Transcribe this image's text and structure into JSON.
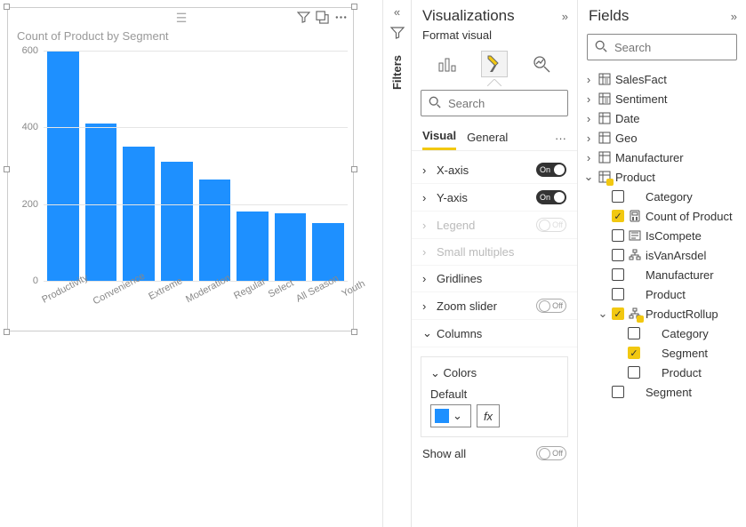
{
  "chart_data": {
    "type": "bar",
    "title": "Count of Product by Segment",
    "categories": [
      "Productivity",
      "Convenience",
      "Extreme",
      "Moderation",
      "Regular",
      "Select",
      "All Season",
      "Youth"
    ],
    "values": [
      600,
      410,
      350,
      310,
      265,
      180,
      175,
      150
    ],
    "ylim": [
      0,
      600
    ],
    "yticks": [
      0,
      200,
      400,
      600
    ],
    "xlabel": "",
    "ylabel": ""
  },
  "filters_label": "Filters",
  "viz": {
    "title": "Visualizations",
    "subtitle": "Format visual",
    "search_placeholder": "Search",
    "tabs": {
      "visual": "Visual",
      "general": "General"
    },
    "rows": {
      "xaxis": {
        "label": "X-axis",
        "state": "on",
        "toggle_text": "On"
      },
      "yaxis": {
        "label": "Y-axis",
        "state": "on",
        "toggle_text": "On"
      },
      "legend": {
        "label": "Legend",
        "state": "off",
        "toggle_text": "Off"
      },
      "small": {
        "label": "Small multiples",
        "state": "none"
      },
      "grid": {
        "label": "Gridlines",
        "state": "none"
      },
      "zoom": {
        "label": "Zoom slider",
        "state": "off",
        "toggle_text": "Off"
      },
      "columns": {
        "label": "Columns",
        "state": "none"
      }
    },
    "colors": {
      "title": "Colors",
      "default_label": "Default",
      "fx": "fx",
      "swatch": "#1e90ff",
      "showall": "Show all",
      "showall_state": "Off"
    }
  },
  "fields": {
    "title": "Fields",
    "search_placeholder": "Search",
    "tables": [
      {
        "name": "SalesFact",
        "icon": "table-sum"
      },
      {
        "name": "Sentiment",
        "icon": "table-sum"
      },
      {
        "name": "Date",
        "icon": "table"
      },
      {
        "name": "Geo",
        "icon": "table"
      },
      {
        "name": "Manufacturer",
        "icon": "table"
      }
    ],
    "product": {
      "name": "Product",
      "fields": [
        {
          "name": "Category",
          "icon": "",
          "checked": false
        },
        {
          "name": "Count of Product",
          "icon": "calc",
          "checked": true
        },
        {
          "name": "IsCompete",
          "icon": "bool",
          "checked": false
        },
        {
          "name": "isVanArsdel",
          "icon": "hier",
          "checked": false
        },
        {
          "name": "Manufacturer",
          "icon": "",
          "checked": false
        },
        {
          "name": "Product",
          "icon": "",
          "checked": false
        }
      ],
      "rollup": {
        "name": "ProductRollup",
        "fields": [
          {
            "name": "Category",
            "checked": false
          },
          {
            "name": "Segment",
            "checked": true
          },
          {
            "name": "Product",
            "checked": false
          }
        ]
      }
    },
    "segment": {
      "name": "Segment"
    }
  }
}
